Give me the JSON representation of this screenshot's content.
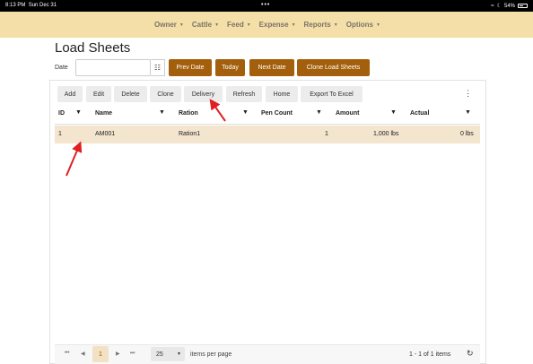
{
  "status": {
    "time": "8:13 PM",
    "date": "Sun Dec 31",
    "battery": "54%"
  },
  "nav": [
    {
      "label": "Owner"
    },
    {
      "label": "Cattle"
    },
    {
      "label": "Feed"
    },
    {
      "label": "Expense"
    },
    {
      "label": "Reports"
    },
    {
      "label": "Options"
    }
  ],
  "page": {
    "title": "Load Sheets"
  },
  "date_filter": {
    "label": "Date",
    "value": ""
  },
  "date_buttons": {
    "prev": "Prev Date",
    "today": "Today",
    "next": "Next Date",
    "clone": "Clone Load Sheets"
  },
  "toolbar": {
    "add": "Add",
    "edit": "Edit",
    "delete": "Delete",
    "clone": "Clone",
    "delivery": "Delivery",
    "refresh": "Refresh",
    "home": "Home",
    "export": "Export To Excel",
    "more": "⋮"
  },
  "columns": {
    "id": "ID",
    "name": "Name",
    "ration": "Ration",
    "pen_count": "Pen Count",
    "amount": "Amount",
    "actual": "Actual"
  },
  "rows": [
    {
      "id": "1",
      "name": "AM001",
      "ration": "Ration1",
      "pen_count": "1",
      "amount": "1,000 lbs",
      "actual": "0 lbs"
    }
  ],
  "pager": {
    "first": "⏮",
    "prev": "◀",
    "current": "1",
    "next": "▶",
    "last": "⏭",
    "page_size": "25",
    "items_per_page": "items per page",
    "range": "1 - 1 of 1 items",
    "refresh": "↻"
  },
  "accent": "#a35f0c",
  "annotation_color": "#e02020"
}
